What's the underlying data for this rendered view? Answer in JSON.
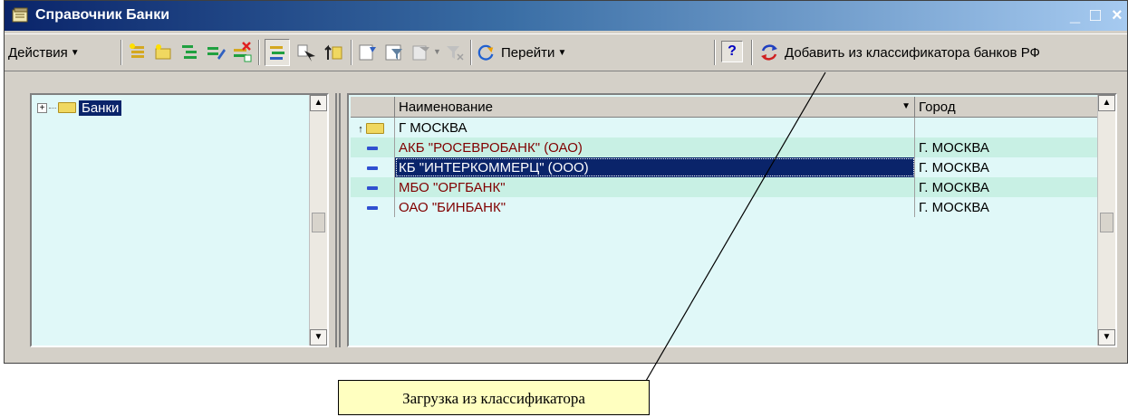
{
  "window": {
    "title": "Справочник Банки",
    "minimize": "_",
    "maximize": "□",
    "close": "×"
  },
  "toolbar": {
    "actions_label": "Действия",
    "goto_label": "Перейти",
    "help_label": "?",
    "add_from_classifier_label": "Добавить из классификатора банков РФ"
  },
  "tree": {
    "root_label": "Банки"
  },
  "table": {
    "columns": [
      "Наименование",
      "Город"
    ],
    "group": {
      "name": "Г МОСКВА",
      "city": ""
    },
    "rows": [
      {
        "name": "АКБ \"РОСЕВРОБАНК\" (ОАО)",
        "city": "Г. МОСКВА"
      },
      {
        "name": "КБ \"ИНТЕРКОММЕРЦ\" (ООО)",
        "city": "Г. МОСКВА",
        "selected": true
      },
      {
        "name": "МБО \"ОРГБАНК\"",
        "city": "Г. МОСКВА"
      },
      {
        "name": "ОАО \"БИНБАНК\"",
        "city": "Г. МОСКВА"
      }
    ]
  },
  "callout": {
    "text": "Загрузка из классификатора"
  },
  "colors": {
    "titlebar_start": "#0a246a",
    "titlebar_end": "#a6caf0",
    "selection": "#0a246a",
    "list_bg": "#e0f8f8",
    "row_alt": "#c8f0e4",
    "bank_text": "#800000",
    "callout_bg": "#ffffc0"
  }
}
